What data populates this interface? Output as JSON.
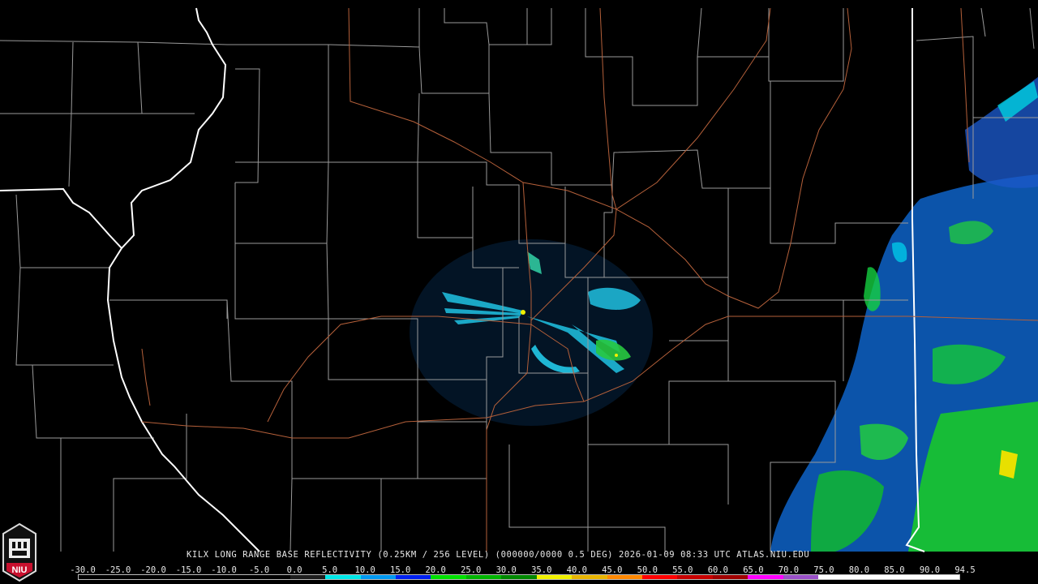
{
  "product_caption": "KILX LONG RANGE BASE REFLECTIVITY (0.25KM / 256 LEVEL) (000000/0000 0.5 DEG) 2026-01-09 08:33 UTC  ATLAS.NIU.EDU",
  "logo_text": "NIU",
  "scale_values": [
    "-30.0",
    "-25.0",
    "-20.0",
    "-15.0",
    "-10.0",
    "-5.0",
    "0.0",
    "5.0",
    "10.0",
    "15.0",
    "20.0",
    "25.0",
    "30.0",
    "35.0",
    "40.0",
    "45.0",
    "50.0",
    "55.0",
    "60.0",
    "65.0",
    "70.0",
    "75.0",
    "80.0",
    "85.0",
    "90.0",
    "94.5"
  ],
  "colors": {
    "background": "#000000",
    "county_lines": "#9a9a9a",
    "state_lines": "#ffffff",
    "highways": "#b5603a",
    "logo_red": "#c8102e"
  },
  "scale_colors": [
    "#000000",
    "#000000",
    "#000000",
    "#000000",
    "#000000",
    "#000000",
    "#1e1e1e",
    "#00e8e8",
    "#0098f0",
    "#0020f0",
    "#00e000",
    "#00b400",
    "#008800",
    "#f0f000",
    "#e8b400",
    "#ff8800",
    "#ff0000",
    "#c80000",
    "#a00000",
    "#ff00ff",
    "#9a50c8",
    "#ffffff",
    "#ffffff",
    "#ffffff",
    "#ffffff"
  ]
}
